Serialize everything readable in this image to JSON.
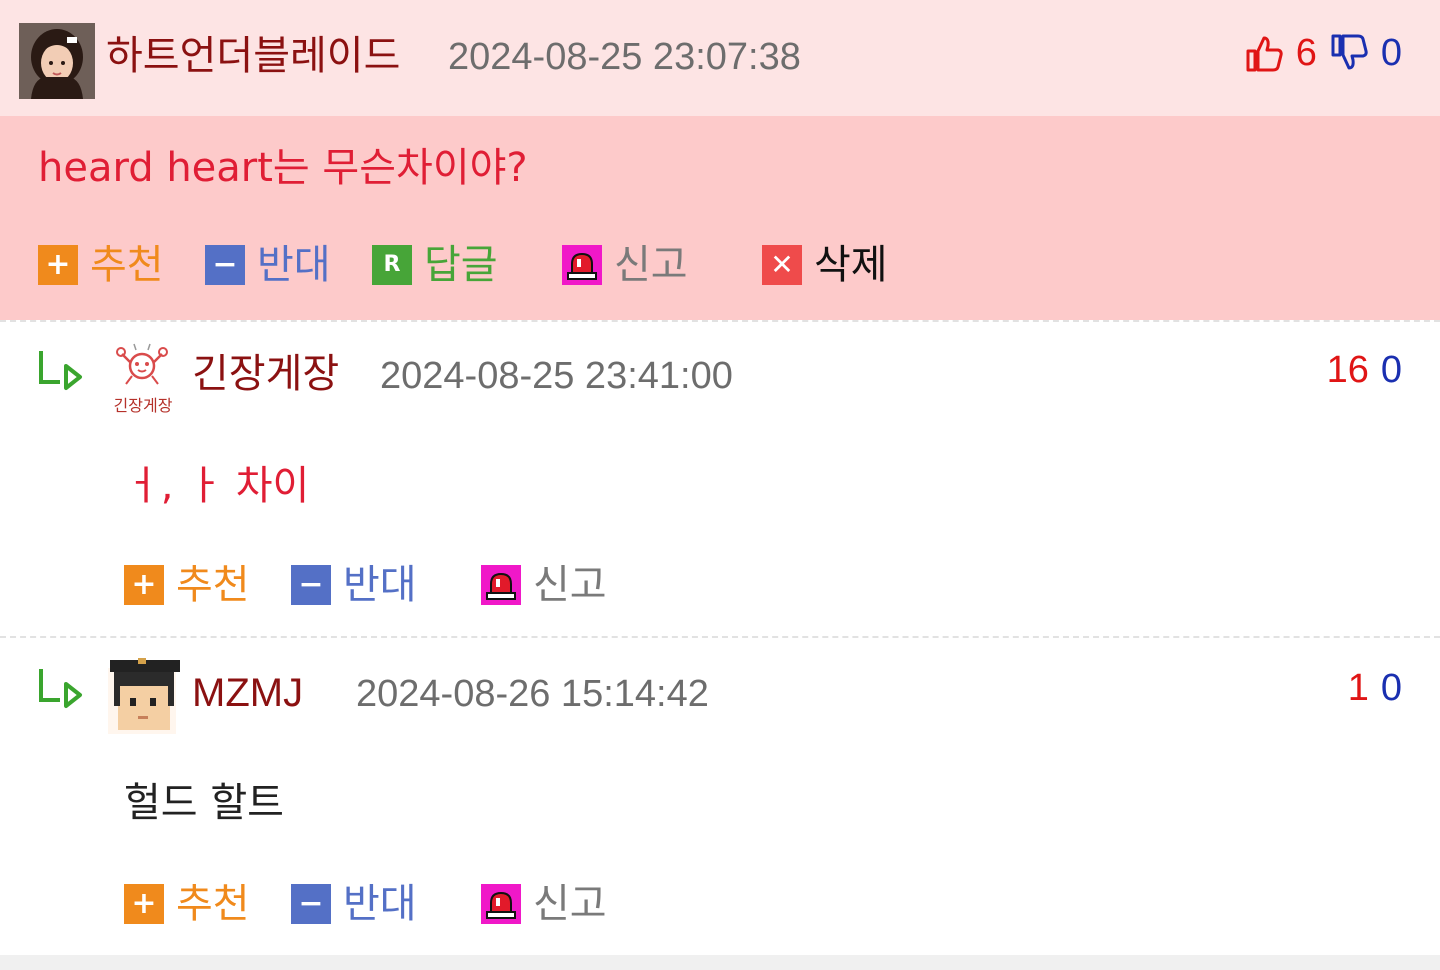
{
  "post": {
    "author": "하트언더블레이드",
    "date": "2024-08-25 23:07:38",
    "upvotes": "6",
    "downvotes": "0",
    "content": "heard heart는 무슨차이야?",
    "actions": {
      "recommend": "추천",
      "oppose": "반대",
      "reply": "답글",
      "report": "신고",
      "delete": "삭제"
    }
  },
  "comments": [
    {
      "author": "긴장게장",
      "avatar_text": "긴장게장",
      "date": "2024-08-25 23:41:00",
      "upvotes": "16",
      "downvotes": "0",
      "content": "ㅓ, ㅏ 차이",
      "actions": {
        "recommend": "추천",
        "oppose": "반대",
        "report": "신고"
      }
    },
    {
      "author": "MZMJ",
      "date": "2024-08-26 15:14:42",
      "upvotes": "1",
      "downvotes": "0",
      "content": "헐드 할트",
      "actions": {
        "recommend": "추천",
        "oppose": "반대",
        "report": "신고"
      }
    }
  ],
  "icons": {
    "thumbs_up": "thumbs-up-icon",
    "thumbs_down": "thumbs-down-icon",
    "plus": "plus-icon",
    "minus": "minus-icon",
    "reply": "reply-icon",
    "report": "siren-icon",
    "delete": "close-icon",
    "reply_arrow": "reply-arrow-icon"
  },
  "colors": {
    "header_bg": "#fde4e4",
    "body_bg": "#fdcaca",
    "name": "#8b1111",
    "upvote": "#e01515",
    "downvote": "#1a2fb0",
    "recommend": "#f08a1c",
    "oppose": "#5470c6",
    "reply": "#47a538",
    "delete": "#ef4b4b",
    "report": "#f018c8",
    "post_text": "#e01e35",
    "comment1_text": "#e01e35",
    "comment2_text": "#222222"
  }
}
